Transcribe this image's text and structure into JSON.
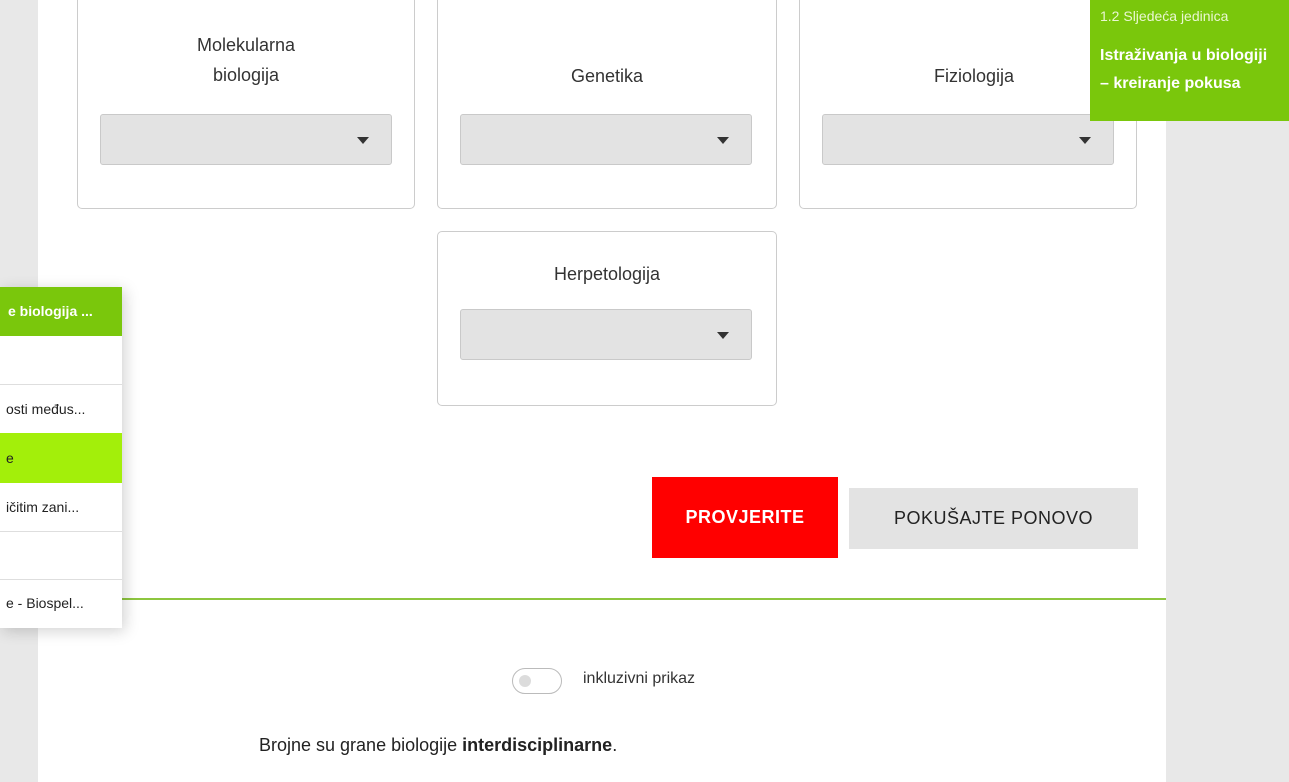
{
  "cards": [
    {
      "label_line1": "Molekularna",
      "label_line2": "biologija",
      "selected": ""
    },
    {
      "label": "Genetika",
      "selected": ""
    },
    {
      "label": "Fiziologija",
      "selected": ""
    },
    {
      "label": "Herpetologija",
      "selected": ""
    }
  ],
  "actions": {
    "check_label": "PROVJERITE",
    "retry_label": "POKUŠAJTE PONOVO"
  },
  "inclusive": {
    "label": "inkluzivni prikaz",
    "enabled": false
  },
  "body": {
    "text_before": "Brojne su grane biologije ",
    "text_bold": "interdisciplinarne",
    "text_after": "."
  },
  "drawer": {
    "header": "e biologija ...",
    "items": [
      "",
      "osti međus...",
      "e",
      "ičitim zani...",
      "",
      "e - Biospel..."
    ]
  },
  "next_unit": {
    "subtitle": "1.2 Sljedeća jedinica",
    "title_line1": "Istraživanja u biologiji",
    "title_line2": "– kreiranje pokusa"
  },
  "colors": {
    "brand_green": "#7ac70c",
    "active_green": "#a3ef0a",
    "check_red": "#ff0000"
  }
}
